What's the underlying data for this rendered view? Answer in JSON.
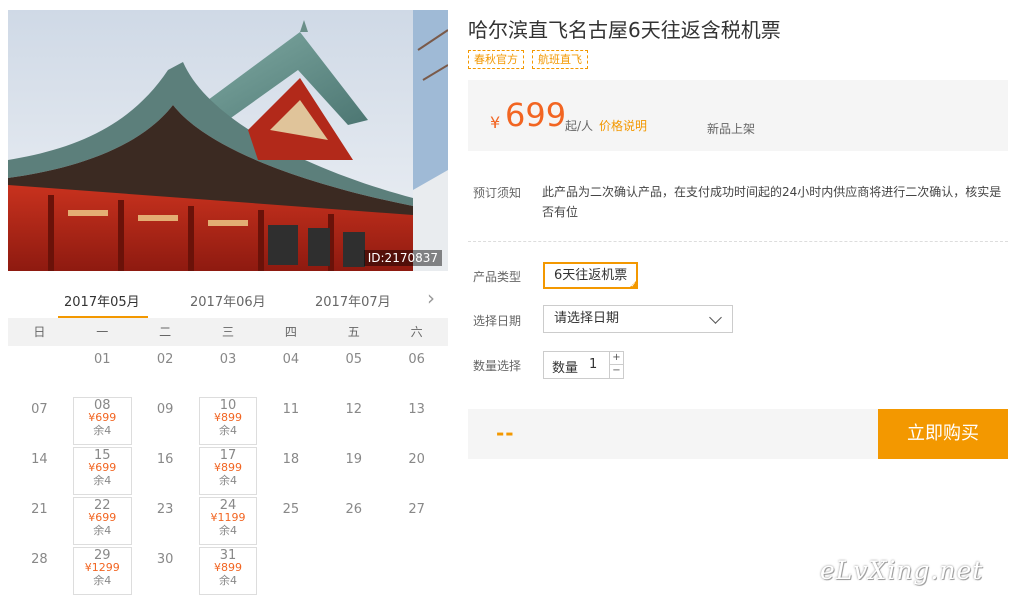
{
  "product": {
    "title": "哈尔滨直飞名古屋6天往返含税机票",
    "tags": [
      "春秋官方",
      "航班直飞"
    ],
    "image_id": "ID:2170837"
  },
  "price": {
    "currency": "¥",
    "amount": "699",
    "unit": "起/人",
    "explain_link": "价格说明",
    "status": "新品上架"
  },
  "notice": {
    "label": "预订须知",
    "text": "此产品为二次确认产品，在支付成功时间起的24小时内供应商将进行二次确认，核实是否有位"
  },
  "options": {
    "type_label": "产品类型",
    "type_value": "6天往返机票",
    "date_label": "选择日期",
    "date_placeholder": "请选择日期",
    "qty_label": "数量选择",
    "qty_inner_label": "数量",
    "qty_value": "1",
    "qty_plus": "+",
    "qty_minus": "−"
  },
  "buy": {
    "total": "--",
    "button": "立即购买"
  },
  "calendar": {
    "months": [
      "2017年05月",
      "2017年06月",
      "2017年07月"
    ],
    "active_month": 0,
    "weekdays": [
      "日",
      "一",
      "二",
      "三",
      "四",
      "五",
      "六"
    ],
    "weeks": [
      [
        null,
        {
          "d": "01"
        },
        {
          "d": "02"
        },
        {
          "d": "03"
        },
        {
          "d": "04"
        },
        {
          "d": "05"
        },
        {
          "d": "06"
        }
      ],
      [
        {
          "d": "07"
        },
        {
          "d": "08",
          "p": "¥699",
          "s": "余4"
        },
        {
          "d": "09"
        },
        {
          "d": "10",
          "p": "¥899",
          "s": "余4"
        },
        {
          "d": "11"
        },
        {
          "d": "12"
        },
        {
          "d": "13"
        }
      ],
      [
        {
          "d": "14"
        },
        {
          "d": "15",
          "p": "¥699",
          "s": "余4"
        },
        {
          "d": "16"
        },
        {
          "d": "17",
          "p": "¥899",
          "s": "余4"
        },
        {
          "d": "18"
        },
        {
          "d": "19"
        },
        {
          "d": "20"
        }
      ],
      [
        {
          "d": "21"
        },
        {
          "d": "22",
          "p": "¥699",
          "s": "余4"
        },
        {
          "d": "23"
        },
        {
          "d": "24",
          "p": "¥1199",
          "s": "余4"
        },
        {
          "d": "25"
        },
        {
          "d": "26"
        },
        {
          "d": "27"
        }
      ],
      [
        {
          "d": "28"
        },
        {
          "d": "29",
          "p": "¥1299",
          "s": "余4"
        },
        {
          "d": "30"
        },
        {
          "d": "31",
          "p": "¥899",
          "s": "余4"
        },
        null,
        null,
        null
      ]
    ]
  },
  "watermark": "eLvXing.net",
  "colors": {
    "accent": "#f39800",
    "price": "#f26522",
    "panel_bg": "#f5f5f5"
  }
}
